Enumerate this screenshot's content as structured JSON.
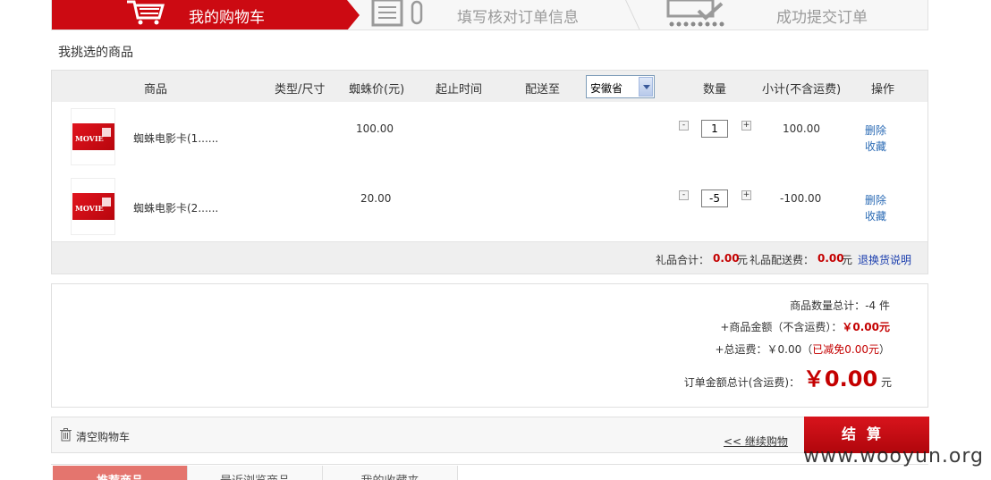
{
  "steps": [
    {
      "label": "我的购物车",
      "state": "active"
    },
    {
      "label": "填写核对订单信息",
      "state": "inactive"
    },
    {
      "label": "成功提交订单",
      "state": "inactive"
    }
  ],
  "section_title": "我挑选的商品",
  "table": {
    "headers": {
      "product": "商品",
      "type_size": "类型/尺寸",
      "price": "蜘蛛价(元)",
      "period": "起止时间",
      "ship_to": "配送至",
      "quantity": "数量",
      "subtotal": "小计(不含运费)",
      "operation": "操作"
    },
    "province_selected": "安徽省",
    "rows": [
      {
        "name": "蜘蛛电影卡(1......",
        "price": "100.00",
        "quantity": "1",
        "subtotal": "100.00",
        "thumb_text": "MOVIE"
      },
      {
        "name": "蜘蛛电影卡(2......",
        "price": "20.00",
        "quantity": "-5",
        "subtotal": "-100.00",
        "thumb_text": "MOVIE"
      }
    ],
    "row_actions": {
      "delete": "删除",
      "favorite": "收藏"
    },
    "qty_minus": "-",
    "qty_plus": "+",
    "gift_bar": {
      "gift_total_label": "礼品合计：",
      "gift_total_value": "0.00",
      "yuan": "元",
      "gift_shipping_label": "礼品配送费：",
      "gift_shipping_value": "0.00",
      "return_policy": "退换货说明"
    }
  },
  "summary": {
    "count_label": "商品数量总计：",
    "count_value": "-4",
    "count_unit": "件",
    "amount_label": "+商品金额（不含运费）：",
    "amount_value": "￥0.00元",
    "shipping_label": "+总运费：￥0.00（",
    "shipping_waived": "已减免0.00元",
    "shipping_close": "）",
    "total_label": "订单金额总计(含运费)：",
    "total_value": "￥0.00",
    "total_unit": "元"
  },
  "actions": {
    "clear_cart": "清空购物车",
    "continue_shopping": "<< 继续购物",
    "checkout": "结算"
  },
  "tabs": [
    {
      "label": "推荐商品",
      "active": true
    },
    {
      "label": "最近浏览商品",
      "active": false
    },
    {
      "label": "我的收藏夹",
      "active": false
    }
  ],
  "watermark": "www.wooyun.org",
  "colors": {
    "brand_red": "#cc0a12",
    "price_red": "#c40000",
    "link_blue": "#2b6bb5"
  }
}
